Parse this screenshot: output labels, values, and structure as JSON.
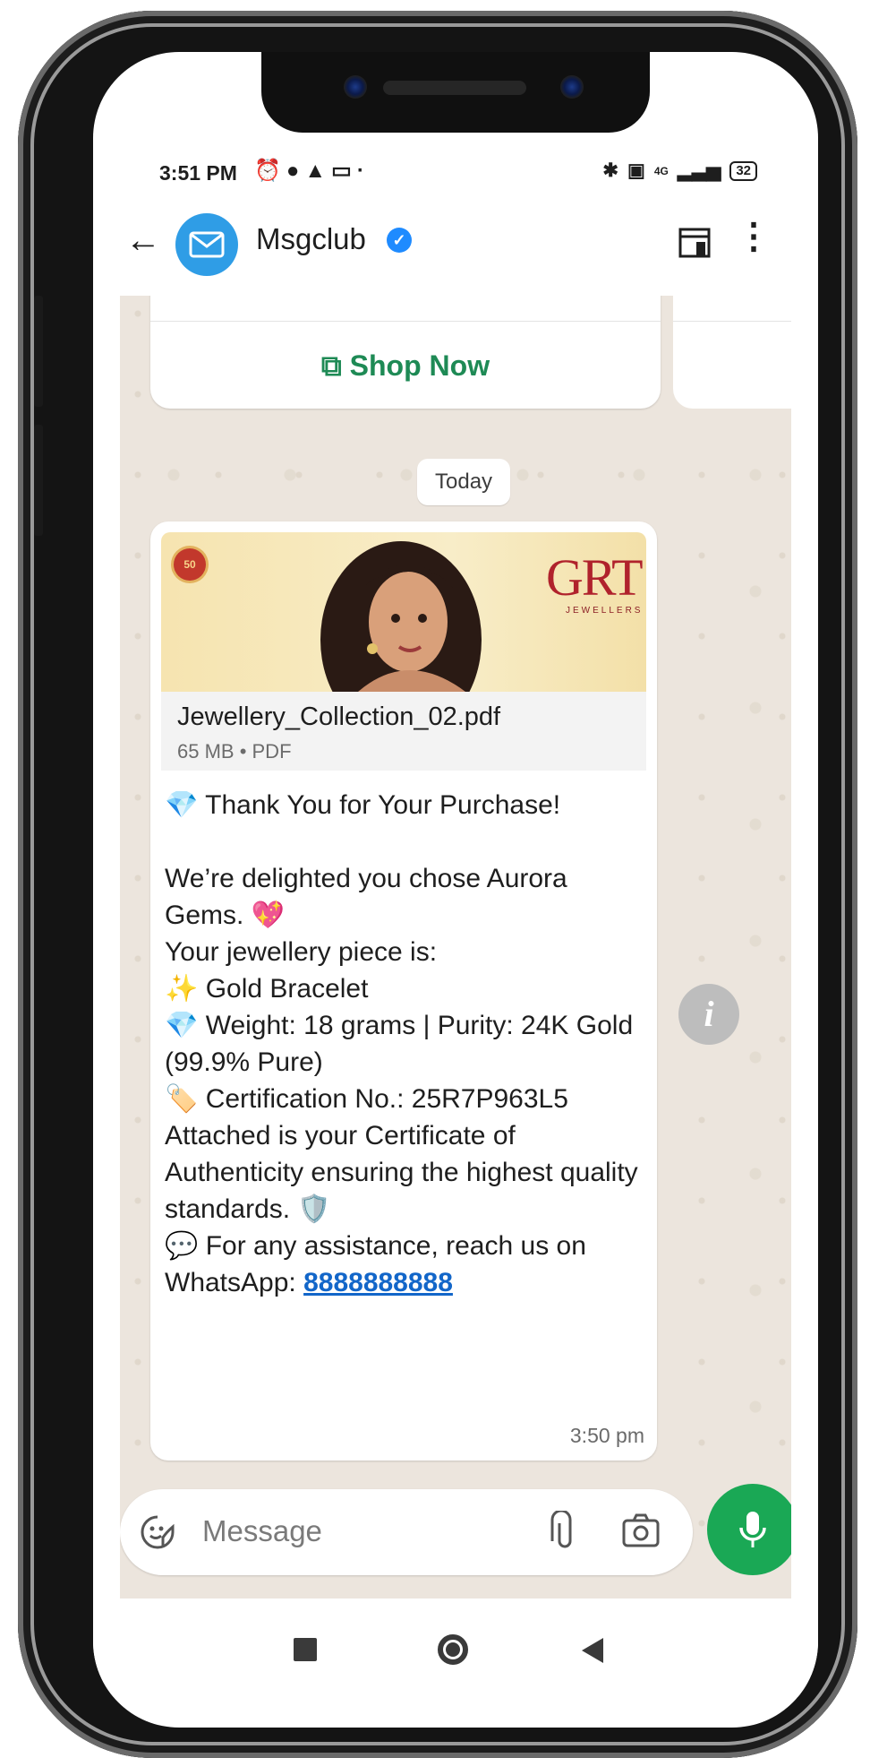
{
  "status_bar": {
    "time": "3:51 PM",
    "left_icons": [
      "alarm-icon",
      "chat-bubble-icon",
      "warning-icon",
      "laptop-icon",
      "dot-icon"
    ],
    "right_icons": [
      "bluetooth-icon",
      "volte-icon",
      "signal-icon"
    ],
    "network": "4G",
    "battery": "32"
  },
  "header": {
    "contact_name": "Msgclub",
    "verified": true,
    "icons": [
      "back-arrow-icon",
      "avatar-mail-icon",
      "verified-badge-icon",
      "store-icon",
      "more-vertical-icon"
    ]
  },
  "chat": {
    "previous_card": {
      "button_label": "Shop Now",
      "button_icon": "external-link-icon"
    },
    "date_separator": "Today",
    "message": {
      "attachment": {
        "file_name": "Jewellery_Collection_02.pdf",
        "meta": "65 MB • PDF",
        "brand_logo": "GRT",
        "brand_sub": "JEWELLERS",
        "seal_text": "50"
      },
      "lines": {
        "heading": "💎 Thank You for Your Purchase!",
        "line1": "We’re delighted you chose Aurora Gems. 💖",
        "line2": "Your jewellery piece is:",
        "line3": "✨ Gold Bracelet",
        "line4": "💎 Weight: 18 grams | Purity: 24K Gold (99.9% Pure)",
        "line5": "🏷️ Certification No.: 25R7P963L5",
        "line6": "Attached is your Certificate of Authenticity ensuring the highest quality standards. 🛡️",
        "line7_prefix": "💬 For any assistance, reach us on WhatsApp: ",
        "phone": "8888888888"
      },
      "timestamp": "3:50 pm"
    }
  },
  "composer": {
    "placeholder": "Message",
    "icons": [
      "emoji-sticker-icon",
      "attach-clip-icon",
      "camera-icon",
      "mic-icon"
    ]
  },
  "colors": {
    "accent_green": "#1aa855",
    "link_blue": "#1266c9",
    "shop_green": "#1e8a55",
    "chat_bg": "#ece5dd"
  }
}
